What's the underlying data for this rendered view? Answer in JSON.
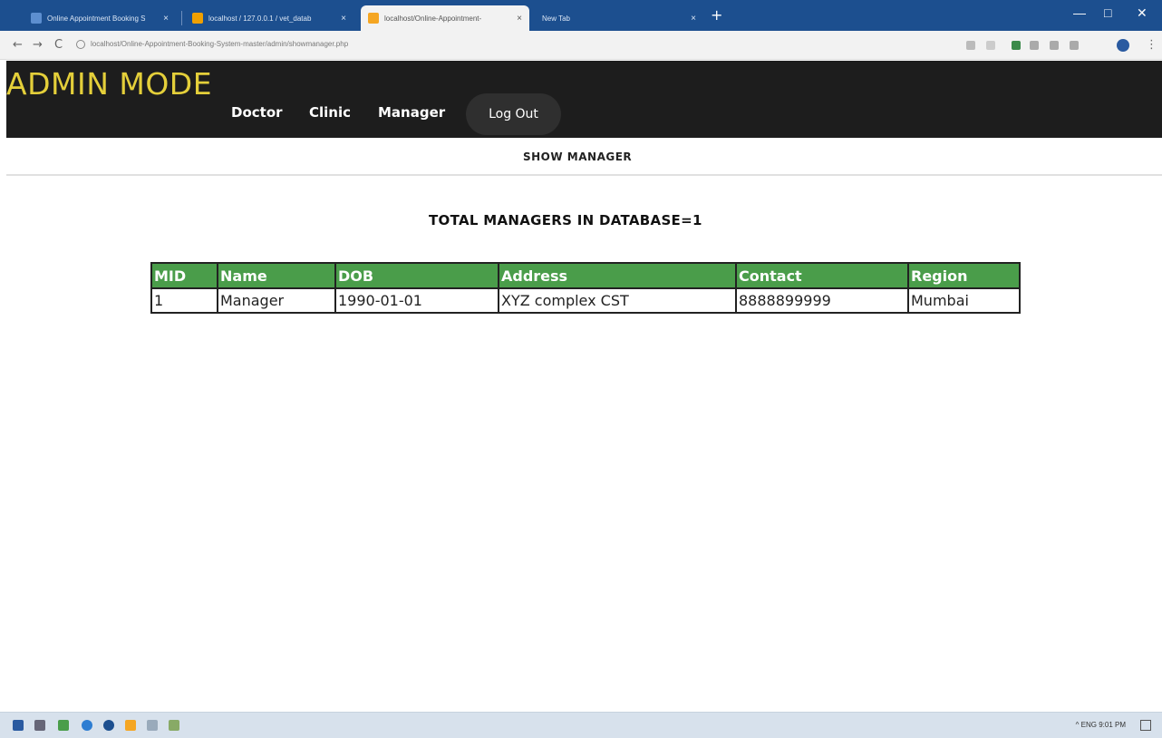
{
  "browser": {
    "tabs": [
      {
        "title": "Online Appointment Booking S",
        "active": false,
        "favicon_color": "#1c4f8f"
      },
      {
        "title": "localhost / 127.0.0.1 / vet_datab",
        "active": false,
        "favicon_color": "#f0a000"
      },
      {
        "title": "localhost/Online-Appointment-",
        "active": true,
        "favicon_color": "#f5a623"
      },
      {
        "title": "New Tab",
        "active": false,
        "favicon_color": "#1c4f8f"
      }
    ],
    "close_symbol": "×",
    "newtab_symbol": "+",
    "window_controls": {
      "minimize": "—",
      "maximize": "□",
      "close": "✕"
    },
    "nav": {
      "back": "←",
      "forward": "→",
      "reload": "C"
    },
    "url": "localhost/Online-Appointment-Booking-System-master/admin/showmanager.php"
  },
  "header": {
    "title": "ADMIN MODE",
    "nav": [
      {
        "label": "Doctor"
      },
      {
        "label": "Clinic"
      },
      {
        "label": "Manager"
      }
    ],
    "logout_label": "Log Out"
  },
  "subnav": {
    "label": "SHOW MANAGER"
  },
  "summary": {
    "total_text": "TOTAL MANAGERS IN DATABASE=1"
  },
  "table": {
    "headers": [
      "MID",
      "Name",
      "DOB",
      "Address",
      "Contact",
      "Region"
    ],
    "rows": [
      [
        "1",
        "Manager",
        "1990-01-01",
        "XYZ complex CST",
        "8888899999",
        "Mumbai"
      ]
    ]
  },
  "taskbar": {
    "tray_text": "^  ENG  9:01 PM"
  },
  "colors": {
    "header_bg": "#1d1d1d",
    "title_color": "#e4cf3a",
    "table_header_bg": "#4a9d4a"
  }
}
